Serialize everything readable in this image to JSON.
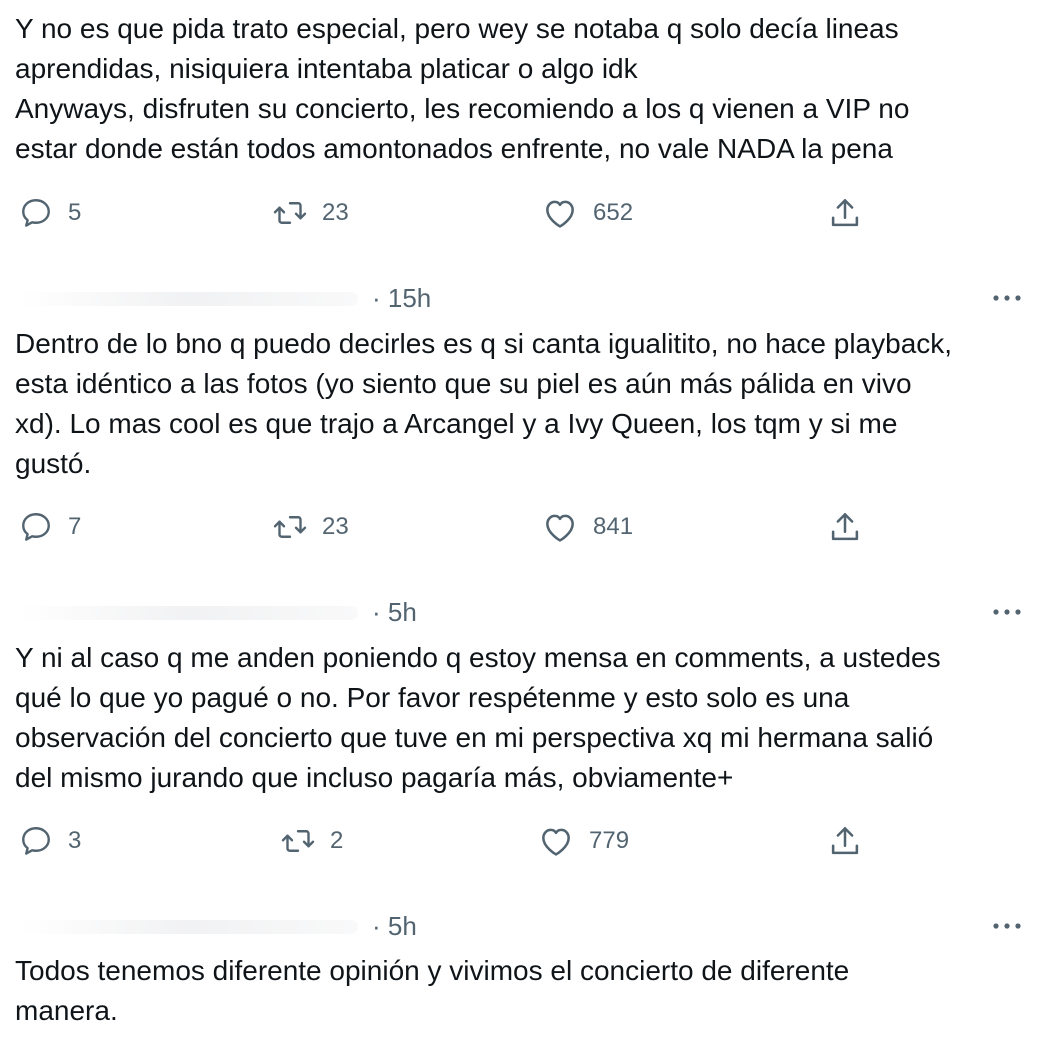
{
  "tweets": [
    {
      "time": "",
      "text": "Y no es que pida trato especial, pero wey se notaba q solo decía lineas\naprendidas, nisiquiera intentaba platicar o algo idk\nAnyways, disfruten su concierto, les recomiendo a los q vienen a VIP no\nestar donde están todos amontonados enfrente, no vale NADA la pena",
      "replies": "5",
      "retweets": "23",
      "likes": "652"
    },
    {
      "time": "· 15h",
      "text": "Dentro de lo bno q puedo decirles es q si canta igualitito, no hace playback,\nesta idéntico a las fotos (yo siento que su piel es aún más pálida en vivo\nxd). Lo mas cool es que trajo a Arcangel y a Ivy Queen, los tqm y si me\ngustó.",
      "replies": "7",
      "retweets": "23",
      "likes": "841"
    },
    {
      "time": "· 5h",
      "text": "Y ni al caso q me anden poniendo q estoy mensa en comments, a ustedes\nqué lo que yo pagué o no. Por favor respétenme y esto solo es una\nobservación del concierto que tuve en mi perspectiva xq mi hermana salió\ndel mismo jurando que incluso pagaría más, obviamente+",
      "replies": "3",
      "retweets": "2",
      "likes": "779"
    },
    {
      "time": "· 5h",
      "text": "Todos tenemos diferente opinión y vivimos el concierto de diferente\nmanera."
    }
  ],
  "icons": {
    "reply": "reply-icon",
    "retweet": "retweet-icon",
    "like": "like-icon",
    "share": "share-icon",
    "more": "more-icon"
  },
  "colors": {
    "text": "#0f1419",
    "secondary": "#536471"
  }
}
